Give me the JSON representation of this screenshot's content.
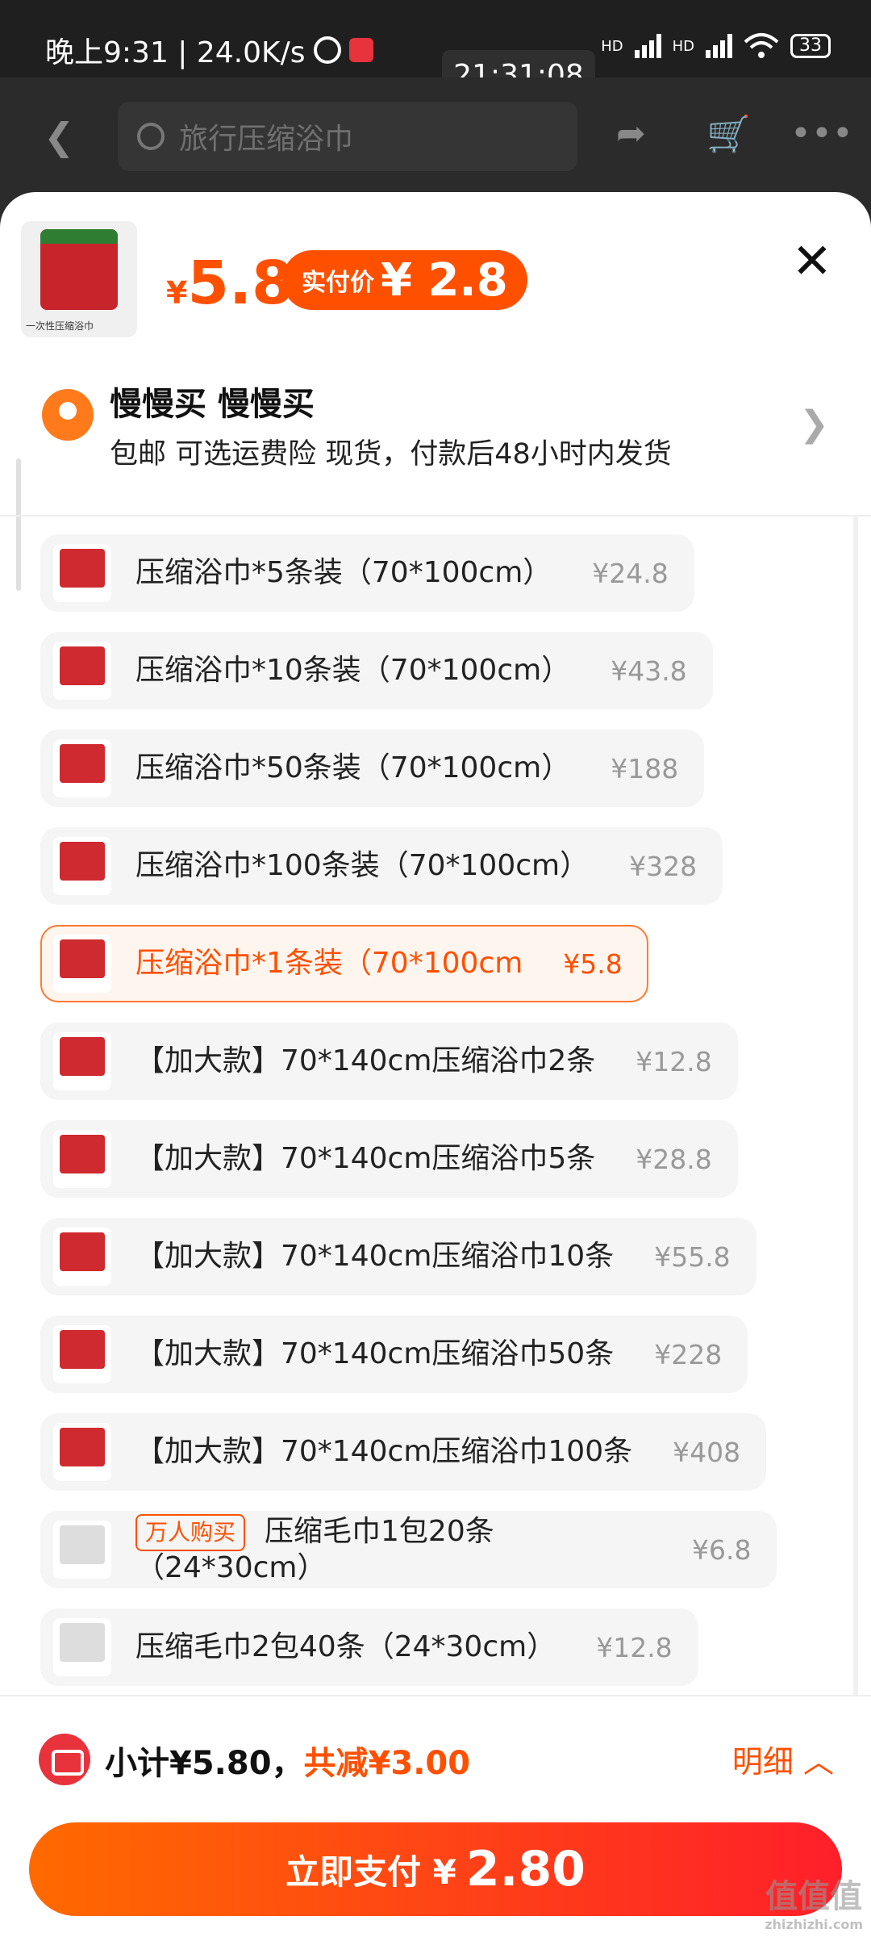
{
  "status_bar": {
    "left_text": "晚上9:31 | 24.0K/s",
    "clock_overlay": "21:31:08",
    "net_badge_1": "HD",
    "net_badge_2": "HD",
    "battery": "33"
  },
  "topbar": {
    "search_placeholder": "旅行压缩浴巾"
  },
  "product": {
    "currency": "¥",
    "price": "5.8",
    "paid_label": "实付价",
    "paid_value": "¥ 2.8",
    "thumb_caption": "一次性压缩浴巾"
  },
  "address": {
    "name": "慢慢买 慢慢买",
    "subtitle": "包邮 可选运费险 现货，付款后48小时内发货"
  },
  "options": [
    {
      "name": "压缩浴巾*5条装（70*100cm）",
      "price": "¥24.8",
      "selected": false
    },
    {
      "name": "压缩浴巾*10条装（70*100cm）",
      "price": "¥43.8",
      "selected": false
    },
    {
      "name": "压缩浴巾*50条装（70*100cm）",
      "price": "¥188",
      "selected": false
    },
    {
      "name": "压缩浴巾*100条装（70*100cm）",
      "price": "¥328",
      "selected": false
    },
    {
      "name": "压缩浴巾*1条装（70*100cm",
      "price": "¥5.8",
      "selected": true
    },
    {
      "name": "【加大款】70*140cm压缩浴巾2条",
      "price": "¥12.8",
      "selected": false
    },
    {
      "name": "【加大款】70*140cm压缩浴巾5条",
      "price": "¥28.8",
      "selected": false
    },
    {
      "name": "【加大款】70*140cm压缩浴巾10条",
      "price": "¥55.8",
      "selected": false
    },
    {
      "name": "【加大款】70*140cm压缩浴巾50条",
      "price": "¥228",
      "selected": false
    },
    {
      "name": "【加大款】70*140cm压缩浴巾100条",
      "price": "¥408",
      "selected": false
    },
    {
      "name": "压缩毛巾1包20条（24*30cm）",
      "price": "¥6.8",
      "selected": false,
      "tag": "万人购买"
    },
    {
      "name": "压缩毛巾2包40条（24*30cm）",
      "price": "¥12.8",
      "selected": false
    }
  ],
  "summary": {
    "subtotal": "小计¥5.80，",
    "discount": "共减¥3.00",
    "detail_label": "明细 ︿"
  },
  "pay_button": {
    "label": "立即支付 ¥",
    "amount": "2.80"
  },
  "watermark": {
    "text": "值值值",
    "domain": "zhizhizhi.com"
  },
  "colors": {
    "accent": "#ff5000",
    "selected_border": "#ff7a33"
  }
}
